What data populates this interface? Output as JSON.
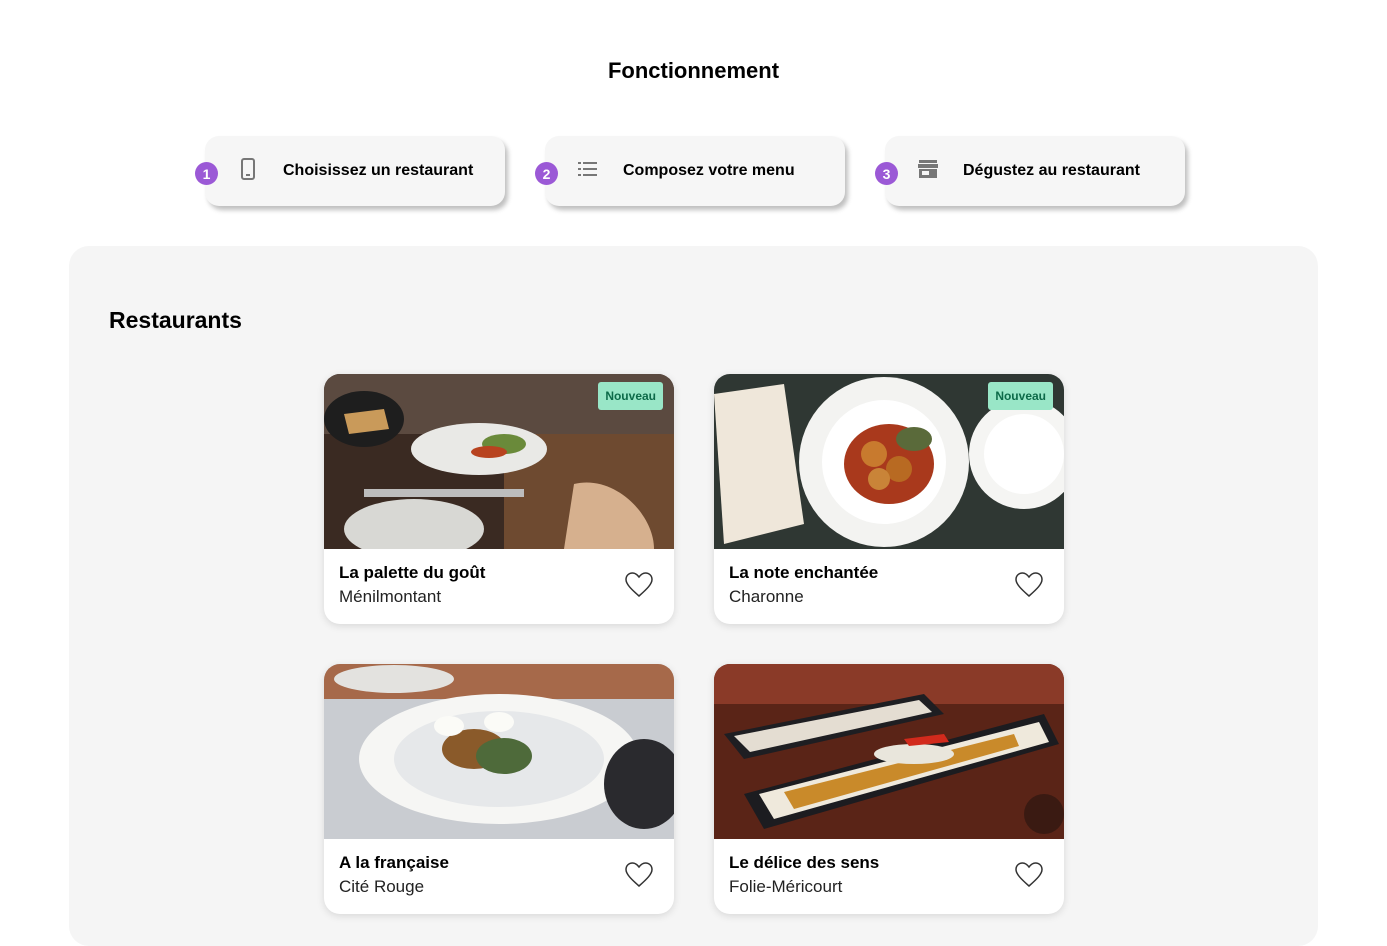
{
  "how": {
    "title": "Fonctionnement",
    "steps": [
      {
        "num": "1",
        "icon": "phone-icon",
        "label": "Choisissez un restaurant"
      },
      {
        "num": "2",
        "icon": "list-icon",
        "label": "Composez votre menu"
      },
      {
        "num": "3",
        "icon": "store-icon",
        "label": "Dégustez au restaurant"
      }
    ]
  },
  "restaurants": {
    "title": "Restaurants",
    "badge": "Nouveau",
    "cards": [
      {
        "name": "La palette du goût",
        "area": "Ménilmontant",
        "is_new": true
      },
      {
        "name": "La note enchantée",
        "area": "Charonne",
        "is_new": true
      },
      {
        "name": "A la française",
        "area": "Cité Rouge",
        "is_new": false
      },
      {
        "name": "Le délice des sens",
        "area": "Folie-Méricourt",
        "is_new": false
      }
    ]
  },
  "colors": {
    "accent": "#9b59d6",
    "badge_bg": "#99e6c7",
    "badge_text": "#0d6a49",
    "section_bg": "#f5f5f5"
  }
}
